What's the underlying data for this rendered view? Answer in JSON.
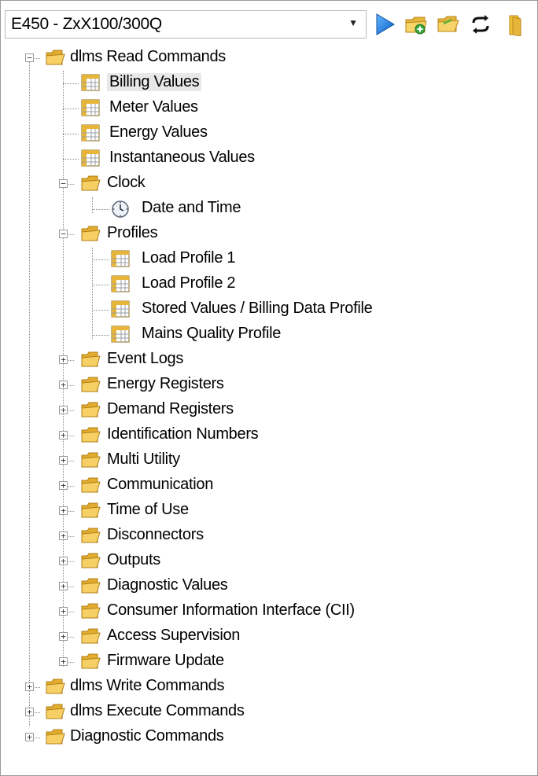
{
  "toolbar": {
    "device_selector": {
      "value": "E450 - ZxX100/300Q"
    },
    "buttons": [
      {
        "name": "run-button",
        "icon": "play-icon"
      },
      {
        "name": "add-folder-button",
        "icon": "folder-add-icon"
      },
      {
        "name": "open-folder-button",
        "icon": "folder-open-icon"
      },
      {
        "name": "refresh-button",
        "icon": "refresh-icon"
      },
      {
        "name": "folder-button",
        "icon": "folder-icon"
      }
    ]
  },
  "tree": {
    "read_commands": {
      "label": "dlms Read Commands",
      "items": {
        "billing_values": "Billing Values",
        "meter_values": "Meter Values",
        "energy_values": "Energy Values",
        "instantaneous_values": "Instantaneous Values",
        "clock": {
          "label": "Clock",
          "date_time": "Date and Time"
        },
        "profiles": {
          "label": "Profiles",
          "load_profile_1": "Load Profile 1",
          "load_profile_2": "Load Profile 2",
          "stored_values": "Stored Values / Billing Data Profile",
          "mains_quality": "Mains Quality Profile"
        },
        "folders": [
          "Event Logs",
          "Energy Registers",
          "Demand Registers",
          "Identification Numbers",
          "Multi Utility",
          "Communication",
          "Time of Use",
          "Disconnectors",
          "Outputs",
          "Diagnostic Values",
          "Consumer Information Interface (CII)",
          "Access Supervision",
          "Firmware Update"
        ]
      }
    },
    "write_commands": "dlms Write Commands",
    "execute_commands": "dlms Execute Commands",
    "diagnostic_commands": "Diagnostic Commands"
  },
  "colors": {
    "folder": "#f3c232",
    "play": "#1f7fe0",
    "selection": "#e8e8e8"
  }
}
